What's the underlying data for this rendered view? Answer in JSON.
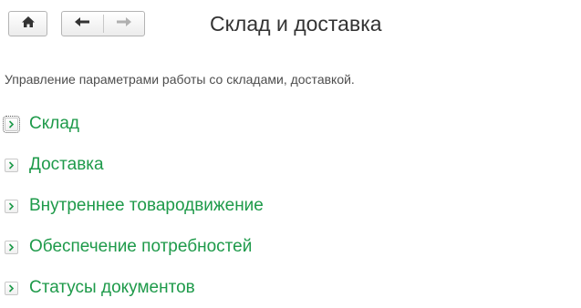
{
  "header": {
    "title": "Склад и доставка"
  },
  "toolbar": {
    "home_icon": "home-icon",
    "back_icon": "arrow-left-icon",
    "forward_icon": "arrow-right-icon"
  },
  "description": "Управление параметрами работы со складами, доставкой.",
  "sections": [
    {
      "label": "Склад",
      "state": "collapsed",
      "focused": true
    },
    {
      "label": "Доставка",
      "state": "collapsed"
    },
    {
      "label": "Внутреннее товародвижение",
      "state": "collapsed"
    },
    {
      "label": "Обеспечение потребностей",
      "state": "collapsed"
    },
    {
      "label": "Статусы документов",
      "state": "collapsed"
    }
  ],
  "colors": {
    "link_green": "#1e9a4a",
    "expander_arrow": "#1e9a4a",
    "title_text": "#333333"
  }
}
